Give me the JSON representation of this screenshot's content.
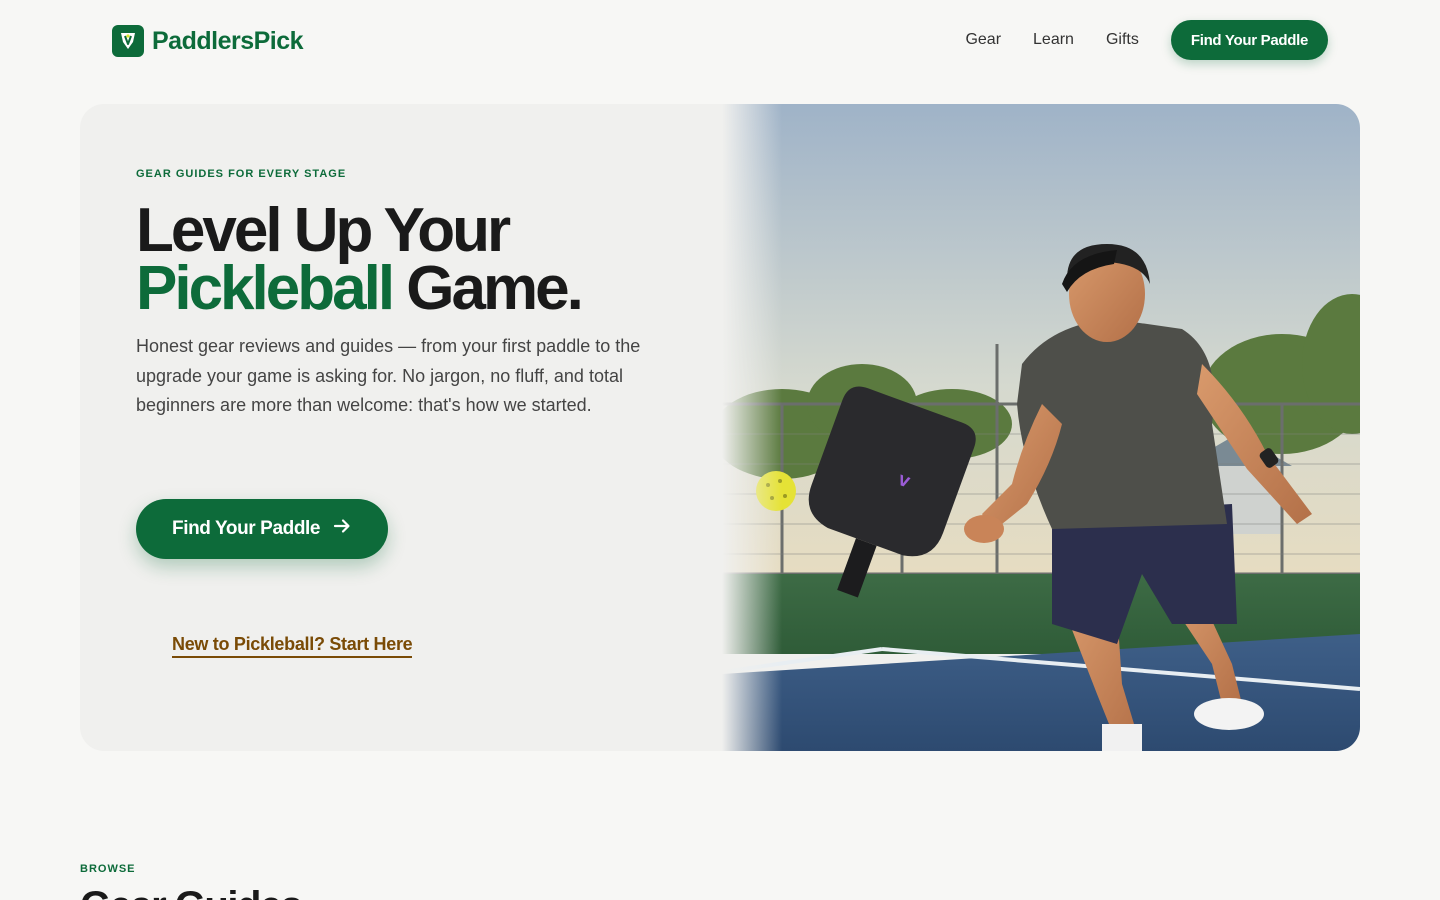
{
  "brand": {
    "name": "PaddlersPick",
    "logo_icon": "paddle-shield-icon"
  },
  "nav": {
    "links": [
      "Gear",
      "Learn",
      "Gifts"
    ],
    "cta_label": "Find Your Paddle"
  },
  "hero": {
    "eyebrow": "GEAR GUIDES FOR EVERY STAGE",
    "headline_line1": "Level Up Your",
    "headline_accent": "Pickleball",
    "headline_rest": "Game.",
    "lede": "Honest gear reviews and guides — from your first paddle to the upgrade your game is asking for. No jargon, no fluff, and total beginners are more than welcome: that's how we started.",
    "cta_label": "Find Your Paddle",
    "cta_icon": "arrow-right-icon",
    "secondary_link": "New to Pickleball? Start Here"
  },
  "browse": {
    "eyebrow": "BROWSE",
    "title": "Gear Guides"
  },
  "colors": {
    "brand_green": "#0d6b3a",
    "link_brown": "#7a4b06",
    "page_bg": "#f7f7f5",
    "hero_bg": "#f0f0ee"
  }
}
